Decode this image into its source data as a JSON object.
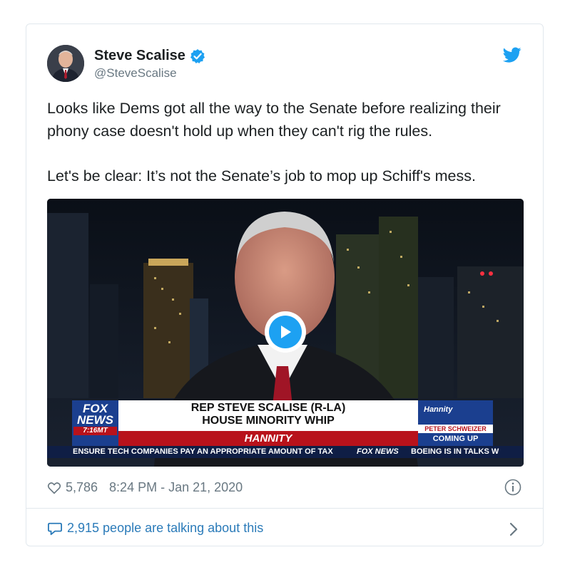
{
  "author": {
    "name": "Steve Scalise",
    "handle": "@SteveScalise"
  },
  "tweet": {
    "paragraph1": "Looks like Dems got all the way to the Senate before realizing their phony case doesn't hold up when they can't rig the rules.",
    "paragraph2": "Let's be clear: It’s not the Senate’s job to mop up Schiff's mess."
  },
  "video": {
    "chyron_line1": "REP STEVE SCALISE (R-LA)",
    "chyron_line2": "HOUSE MINORITY WHIP",
    "show": "HANNITY",
    "network_top": "FOX",
    "network_bottom": "NEWS",
    "time": "7:16MT",
    "promo_logo": "Hannity",
    "promo_name": "PETER SCHWEIZER",
    "promo_status": "COMING UP",
    "ticker_left": "ENSURE TECH COMPANIES PAY AN APPROPRIATE AMOUNT OF TAX",
    "ticker_brand": "FOX NEWS",
    "ticker_right": "BOEING IS IN TALKS W"
  },
  "meta": {
    "likes": "5,786",
    "timestamp": "8:24 PM - Jan 21, 2020"
  },
  "footer": {
    "talking": "2,915 people are talking about this"
  },
  "icons": {
    "verified": "verified-badge-icon",
    "twitter": "twitter-bird-icon",
    "play": "play-icon",
    "heart": "heart-icon",
    "info": "info-icon",
    "comment": "comment-bubble-icon",
    "chevron": "chevron-right-icon"
  },
  "colors": {
    "twitter_blue": "#1da1f2",
    "link_blue": "#2b7bb9",
    "text": "#1c2022",
    "muted": "#697882",
    "border": "#e1e8ed",
    "fox_red": "#b8121b",
    "fox_blue": "#1b3f8f"
  }
}
